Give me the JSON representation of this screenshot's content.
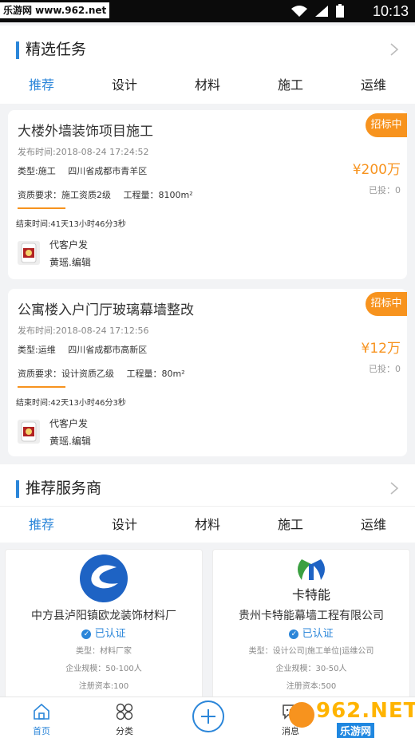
{
  "status_bar": {
    "watermark": "乐游网 www.962.net",
    "time": "10:13"
  },
  "tasks_section": {
    "title": "精选任务",
    "tabs": [
      "推荐",
      "设计",
      "材料",
      "施工",
      "运维"
    ]
  },
  "tasks": [
    {
      "title": "大楼外墙装饰项目施工",
      "badge": "招标中",
      "publish_time": "发布时间:2018-08-24 17:24:52",
      "type": "类型:施工",
      "location": "四川省成都市青羊区",
      "price": "¥200万",
      "qualification": "资质要求：施工资质2级",
      "quantity": "工程量：8100m²",
      "bids": "已投：0",
      "end_time": "结束时间:41天13小时46分3秒",
      "poster": "代客户发",
      "poster_name": "黄瑶.编辑"
    },
    {
      "title": "公寓楼入户门厅玻璃幕墙整改",
      "badge": "招标中",
      "publish_time": "发布时间:2018-08-24 17:12:56",
      "type": "类型:运维",
      "location": "四川省成都市高新区",
      "price": "¥12万",
      "qualification": "资质要求：设计资质乙级",
      "quantity": "工程量：80m²",
      "bids": "已投：0",
      "end_time": "结束时间:42天13小时46分3秒",
      "poster": "代客户发",
      "poster_name": "黄瑶.编辑"
    }
  ],
  "providers_section": {
    "title": "推荐服务商",
    "tabs": [
      "推荐",
      "设计",
      "材料",
      "施工",
      "运维"
    ]
  },
  "providers": [
    {
      "name": "中方县泸阳镇欧龙装饰材料厂",
      "certified": "已认证",
      "type": "类型：材料厂家",
      "scale": "企业规模：50-100人",
      "capital": "注册资本:100",
      "extra": "ˊ业"
    },
    {
      "name": "贵州卡特能幕墙工程有限公司",
      "logo_text": "卡特能",
      "certified": "已认证",
      "type": "类型：设计公司|施工单位|运维公司",
      "scale": "企业规模：30-50人",
      "capital": "注册资本:500",
      "extra": "ˊ业"
    }
  ],
  "bottom_nav": {
    "home": "首页",
    "category": "分类",
    "messages": "消息"
  },
  "watermark_962": {
    "big": "962.NET",
    "small": "乐游网"
  },
  "colors": {
    "accent": "#2b86d9",
    "orange": "#f7931e"
  }
}
